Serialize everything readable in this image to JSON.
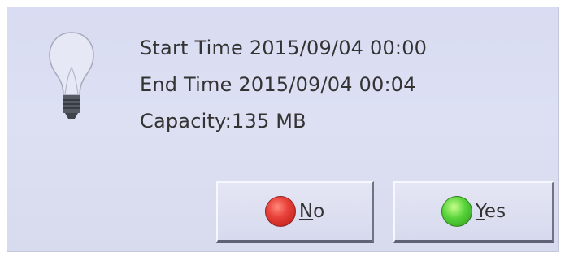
{
  "dialog": {
    "icon": "lightbulb-icon",
    "lines": [
      "Start Time 2015/09/04 00:00",
      "End Time 2015/09/04 00:04",
      "Capacity:135 MB"
    ]
  },
  "buttons": {
    "no": {
      "mnemonic": "N",
      "rest": "o",
      "icon": "red-circle-icon",
      "color": "#e03a33"
    },
    "yes": {
      "mnemonic": "Y",
      "rest": "es",
      "icon": "green-circle-icon",
      "color": "#4fc632"
    }
  }
}
